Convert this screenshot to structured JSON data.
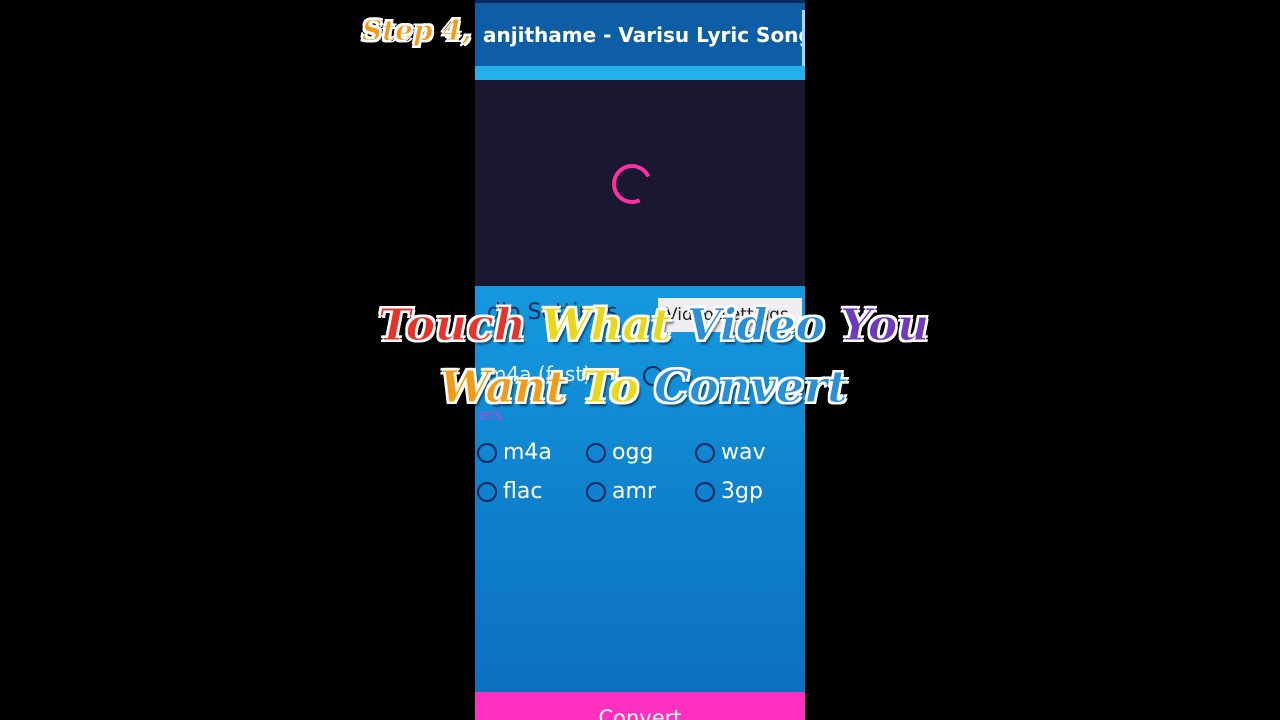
{
  "overlay": {
    "step": "Step 4,",
    "headline_line1_words": [
      "Touch",
      "What",
      "Video",
      "You"
    ],
    "headline_line2_words": [
      "Want",
      "To",
      "Convert"
    ],
    "rainbow_colors": [
      "#e8332b",
      "#f39a17",
      "#e9d81a",
      "#34b24c",
      "#2a8fd6",
      "#6f3bbd"
    ]
  },
  "app": {
    "video_title": "anjithame - Varisu Lyric Song (Ta...",
    "audio_settings_label": "dio Settings",
    "video_settings_button": "Video Settings",
    "mode_label": "m4a (fast)",
    "mode_alt": "mp3",
    "others_label": "ers",
    "formats": [
      "m4a",
      "ogg",
      "wav",
      "flac",
      "amr",
      "3gp"
    ],
    "convert_button": "Convert",
    "loading_indicator": "spinner-icon"
  },
  "colors": {
    "accent_pink": "#ff2fbf",
    "spinner": "#ff2fa6",
    "title_bar": "#0e5ea6",
    "video_bg": "#1a1730"
  }
}
